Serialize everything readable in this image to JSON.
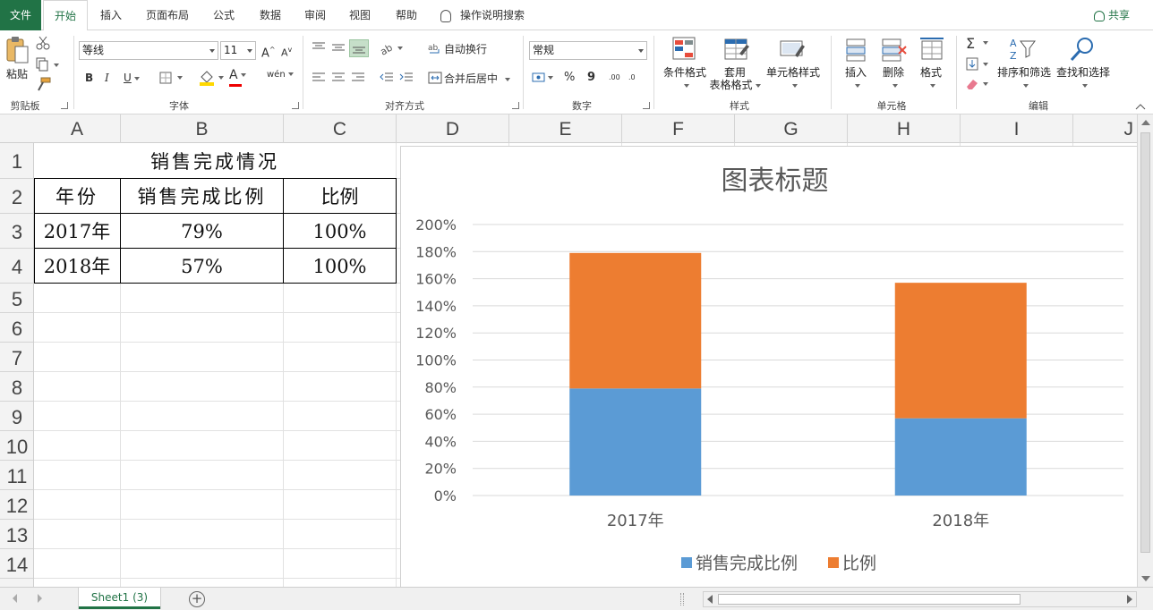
{
  "menu": {
    "tabs": [
      "文件",
      "开始",
      "插入",
      "页面布局",
      "公式",
      "数据",
      "审阅",
      "视图",
      "帮助"
    ],
    "tell_me": "操作说明搜索",
    "share": "共享"
  },
  "ribbon": {
    "clipboard": {
      "paste": "粘贴",
      "label": "剪贴板"
    },
    "font": {
      "name": "等线",
      "size": "11",
      "bold": "B",
      "italic": "I",
      "underline": "U",
      "grow": "A",
      "shrink": "A",
      "font_color_letter": "A",
      "phonetic": "wén",
      "label": "字体"
    },
    "alignment": {
      "wrap": "自动换行",
      "merge": "合并后居中",
      "label": "对齐方式"
    },
    "number": {
      "format": "常规",
      "percent": "%",
      "comma": "9",
      "inc": ".00",
      "dec": ".0",
      "label": "数字"
    },
    "styles": {
      "cond": "条件格式",
      "table1": "套用",
      "table2": "表格格式",
      "cell": "单元格样式",
      "label": "样式"
    },
    "cells": {
      "insert": "插入",
      "delete": "删除",
      "format": "格式",
      "label": "单元格"
    },
    "editing": {
      "sort": "排序和筛选",
      "find": "查找和选择",
      "label": "编辑"
    }
  },
  "columns": [
    "A",
    "B",
    "C",
    "D",
    "E",
    "F",
    "G",
    "H",
    "I",
    "J"
  ],
  "rows": [
    "1",
    "2",
    "3",
    "4",
    "5",
    "6",
    "7",
    "8",
    "9",
    "10",
    "11",
    "12",
    "13",
    "14"
  ],
  "table": {
    "title": "销售完成情况",
    "headers": [
      "年份",
      "销售完成比例",
      "比例"
    ],
    "data": [
      [
        "2017年",
        "79%",
        "100%"
      ],
      [
        "2018年",
        "57%",
        "100%"
      ]
    ]
  },
  "chart_data": {
    "type": "bar",
    "stacked": true,
    "title": "图表标题",
    "categories": [
      "2017年",
      "2018年"
    ],
    "series": [
      {
        "name": "销售完成比例",
        "values": [
          79,
          57
        ],
        "color": "#5b9bd5"
      },
      {
        "name": "比例",
        "values": [
          100,
          100
        ],
        "color": "#ed7d31"
      }
    ],
    "ylim": [
      0,
      200
    ],
    "yticks": [
      "0%",
      "20%",
      "40%",
      "60%",
      "80%",
      "100%",
      "120%",
      "140%",
      "160%",
      "180%",
      "200%"
    ],
    "grid": true,
    "legend": "bottom"
  },
  "sheet": {
    "tab": "Sheet1 (3)",
    "add": "+"
  }
}
